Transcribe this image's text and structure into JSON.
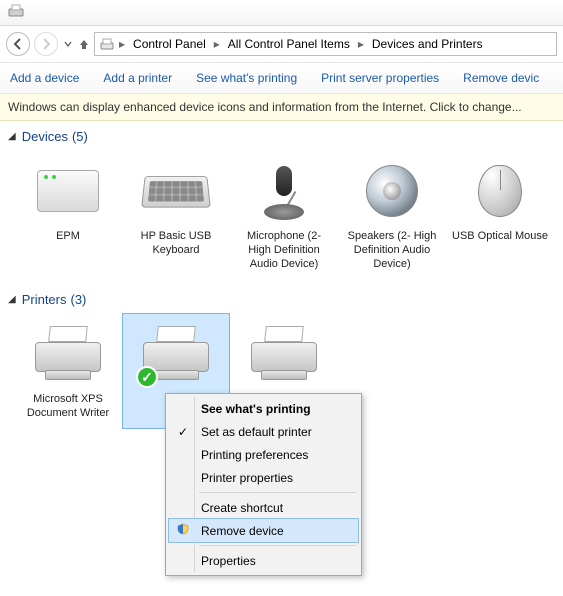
{
  "breadcrumb": {
    "items": [
      "Control Panel",
      "All Control Panel Items",
      "Devices and Printers"
    ]
  },
  "toolbar": {
    "add_device": "Add a device",
    "add_printer": "Add a printer",
    "see_printing": "See what's printing",
    "server_props": "Print server properties",
    "remove_device": "Remove devic"
  },
  "infobar": {
    "text": "Windows can display enhanced device icons and information from the Internet. Click to change..."
  },
  "groups": {
    "devices": {
      "label": "Devices",
      "count": "(5)"
    },
    "printers": {
      "label": "Printers",
      "count": "(3)"
    }
  },
  "devices": [
    {
      "label": "EPM"
    },
    {
      "label": "HP Basic USB Keyboard"
    },
    {
      "label": "Microphone (2- High Definition Audio Device)"
    },
    {
      "label": "Speakers (2- High Definition Audio Device)"
    },
    {
      "label": "USB Optical Mouse"
    }
  ],
  "printers": [
    {
      "label": "Microsoft XPS Document Writer"
    },
    {
      "label": ""
    },
    {
      "label": ""
    }
  ],
  "context_menu": {
    "see_printing": "See what's printing",
    "set_default": "Set as default printer",
    "prefs": "Printing preferences",
    "props": "Printer properties",
    "shortcut": "Create shortcut",
    "remove": "Remove device",
    "properties": "Properties"
  }
}
